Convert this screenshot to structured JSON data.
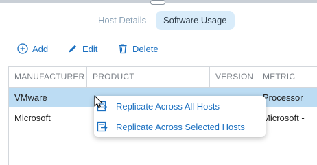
{
  "tabs": [
    {
      "label": "Host Details",
      "active": false
    },
    {
      "label": "Software Usage",
      "active": true
    }
  ],
  "toolbar": {
    "add_label": "Add",
    "edit_label": "Edit",
    "delete_label": "Delete"
  },
  "grid": {
    "columns": [
      "MANUFACTURER",
      "PRODUCT",
      "VERSION",
      "METRIC"
    ],
    "rows": [
      {
        "manufacturer": "VMware",
        "product": "",
        "version": "",
        "metric": "Processor",
        "selected": true
      },
      {
        "manufacturer": "Microsoft",
        "product": "",
        "version": "",
        "metric": "Microsoft -",
        "selected": false
      }
    ]
  },
  "context_menu": {
    "items": [
      {
        "label": "Replicate Across All Hosts",
        "icon": "replicate-icon"
      },
      {
        "label": "Replicate Across Selected Hosts",
        "icon": "replicate-icon"
      }
    ]
  },
  "colors": {
    "accent": "#1a6fc0",
    "selected_row": "#bcdcf3",
    "active_tab_bg": "#d9ecfa"
  }
}
